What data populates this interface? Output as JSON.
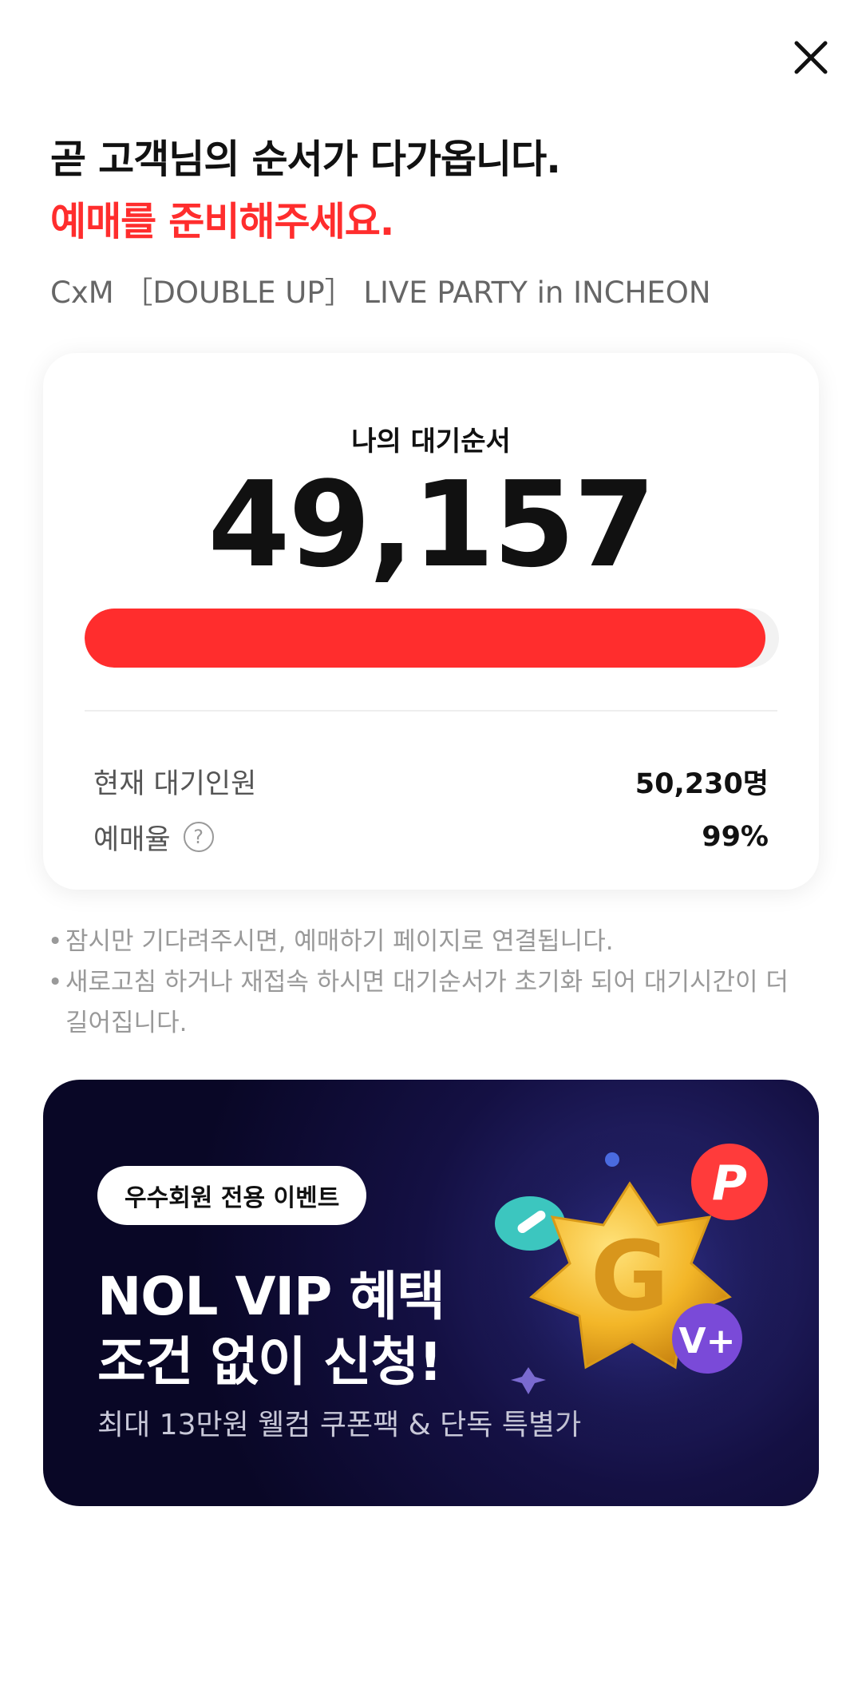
{
  "header": {
    "close_icon": "close-icon"
  },
  "title": {
    "line1": "곧 고객님의 순서가 다가옵니다.",
    "line2": "예매를 준비해주세요.",
    "event_name": "CxM ［DOUBLE UP］ LIVE PARTY in INCHEON"
  },
  "queue": {
    "label": "나의 대기순서",
    "position": "49,157",
    "progress_fraction": 0.98,
    "stats": [
      {
        "label": "현재 대기인원",
        "value": "50,230명"
      },
      {
        "label": "예매율",
        "value": "99%",
        "help_icon": "question-circle-icon",
        "help_glyph": "?"
      }
    ]
  },
  "notices": [
    "잠시만 기다려주시면, 예매하기 페이지로 연결됩니다.",
    "새로고침 하거나 재접속 하시면 대기순서가 초기화 되어 대기시간이 더 길어집니다."
  ],
  "notice_bullet": "•",
  "banner": {
    "badge": "우수회원 전용 이벤트",
    "title_line1": "NOL VIP 혜택",
    "title_line2": "조건 없이 신청!",
    "description": "최대 13만원 웰컴 쿠폰팩 & 단독 특별가",
    "art_icon": "gold-star-g-coin-icon",
    "art_glyphs": {
      "center": "G",
      "red_coin": "P",
      "purple_coin": "V+"
    }
  },
  "colors": {
    "accent": "#ff2d2d",
    "text_primary": "#111111",
    "text_secondary": "#666666",
    "banner_bg": "#0b0930"
  }
}
